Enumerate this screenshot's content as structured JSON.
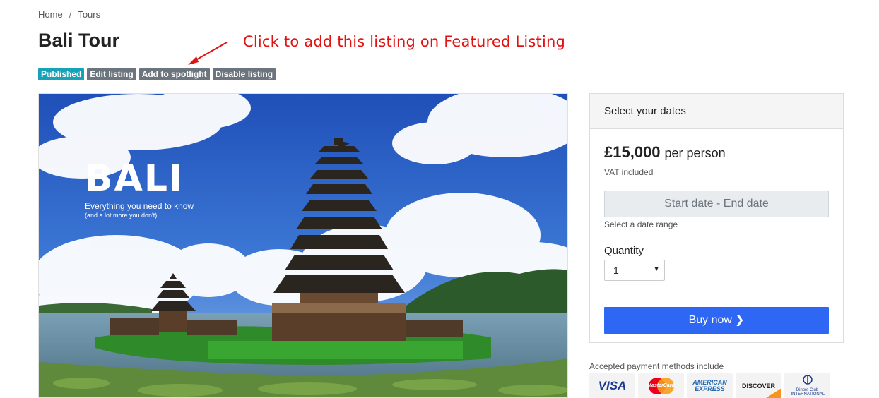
{
  "breadcrumb": {
    "home": "Home",
    "separator": "/",
    "current": "Tours"
  },
  "page_title": "Bali Tour",
  "annotation": "Click to add this listing on Featured Listing",
  "badges": {
    "published": "Published",
    "edit": "Edit listing",
    "spotlight": "Add to spotlight",
    "disable": "Disable listing"
  },
  "hero": {
    "title": "BALI",
    "subtitle": "Everything you need to know",
    "subtitle_small": "(and a lot more you don't)"
  },
  "booking": {
    "header": "Select your dates",
    "price": "£15,000",
    "per": "per person",
    "vat": "VAT included",
    "date_button": "Start date - End date",
    "date_hint": "Select a date range",
    "quantity_label": "Quantity",
    "quantity_value": "1",
    "buy_label": "Buy now"
  },
  "payment": {
    "label": "Accepted payment methods include",
    "cards": [
      "VISA",
      "MasterCard",
      "AMERICAN EXPRESS",
      "DISCOVER",
      "Diners Club INTERNATIONAL"
    ]
  },
  "colors": {
    "accent": "#2f67f5",
    "published": "#17a2b8",
    "badge": "#6c757d",
    "annotation": "#e31212"
  }
}
